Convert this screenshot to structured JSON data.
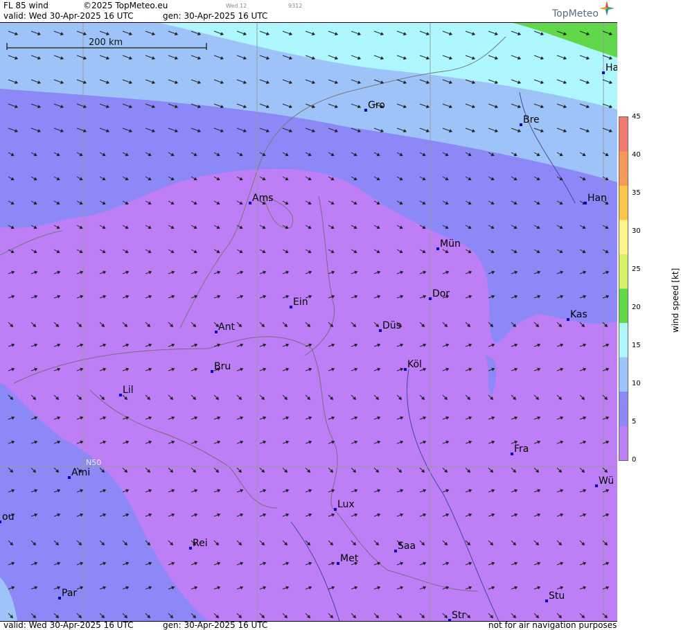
{
  "header": {
    "product": "FL 85 wind",
    "copyright": "©2025 TopMeteo.eu",
    "day_hour": "Wed 12",
    "code": "9312",
    "valid": "valid:  Wed  30-Apr-2025  16 UTC",
    "generated": "gen: 30-Apr-2025 16 UTC"
  },
  "footer": {
    "valid": "valid:  Wed  30-Apr-2025  16 UTC",
    "generated": "gen: 30-Apr-2025 16 UTC",
    "disclaimer": "not for air navigation purposes"
  },
  "logo": {
    "text": "TopMeteo",
    "icon": "compass-star-icon"
  },
  "map": {
    "scale_label": "200 km",
    "latitude_label": "N50",
    "cities": [
      "Ha",
      "Gro",
      "Bre",
      "Ams",
      "Han",
      "Mün",
      "Ein",
      "Dor",
      "Ant",
      "Düs",
      "Kas",
      "Bru",
      "Köl",
      "Lil",
      "Fra",
      "Ami",
      "Wü",
      "Lux",
      "ou",
      "Rei",
      "Saa",
      "Met",
      "Par",
      "Stu",
      "Str"
    ]
  },
  "legend": {
    "title": "wind  speed  [kt]",
    "ticks": [
      "45",
      "40",
      "35",
      "30",
      "25",
      "20",
      "15",
      "10",
      "5",
      "0"
    ],
    "colors": [
      "#f07a70",
      "#f59a58",
      "#fac64a",
      "#fdf58a",
      "#d7f06a",
      "#60d84a",
      "#aef7ff",
      "#9ec3f9",
      "#8c88f7",
      "#bd7ef6"
    ]
  },
  "colors": {
    "band_0_5": "#bd7ef6",
    "band_5_10": "#8c88f7",
    "band_10_15": "#9ec3f9",
    "band_15_20": "#aef7ff",
    "band_20_25": "#60d84a"
  }
}
